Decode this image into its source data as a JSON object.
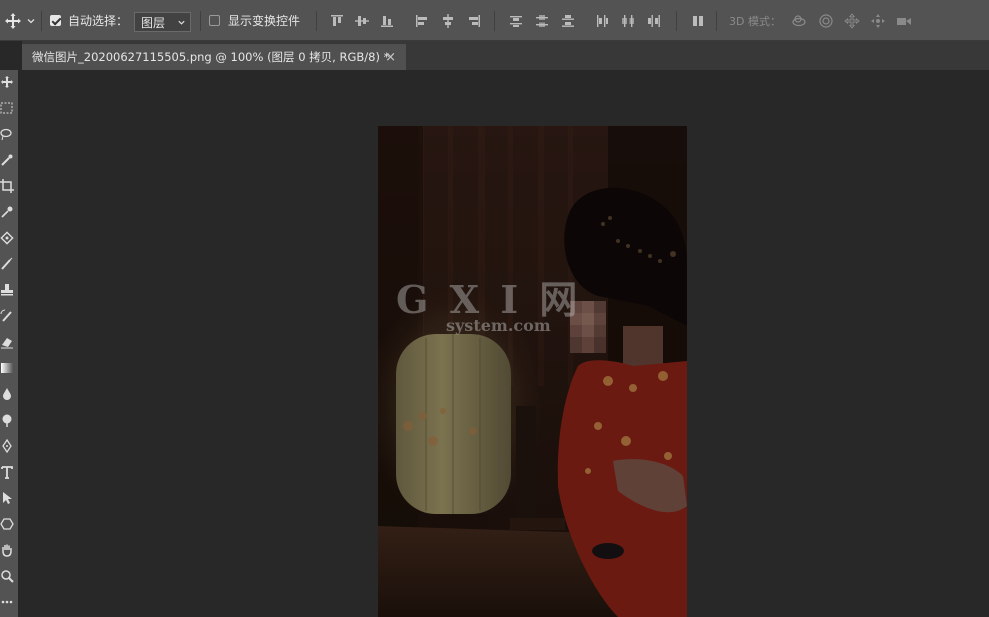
{
  "options_bar": {
    "auto_select_label": "自动选择：",
    "auto_select_checked": true,
    "layer_select_value": "图层",
    "show_transform_label": "显示变换控件",
    "show_transform_checked": false,
    "mode_3d_label": "3D 模式："
  },
  "document_tab": {
    "title": "微信图片_20200627115505.png @ 100% (图层 0 拷贝, RGB/8) *",
    "close": "×"
  },
  "watermark": {
    "logo_text": "G X I 网",
    "domain_text": "system.com"
  },
  "colors": {
    "ui_panel": "#535353",
    "workspace": "#282828",
    "tab_active": "#505050"
  }
}
